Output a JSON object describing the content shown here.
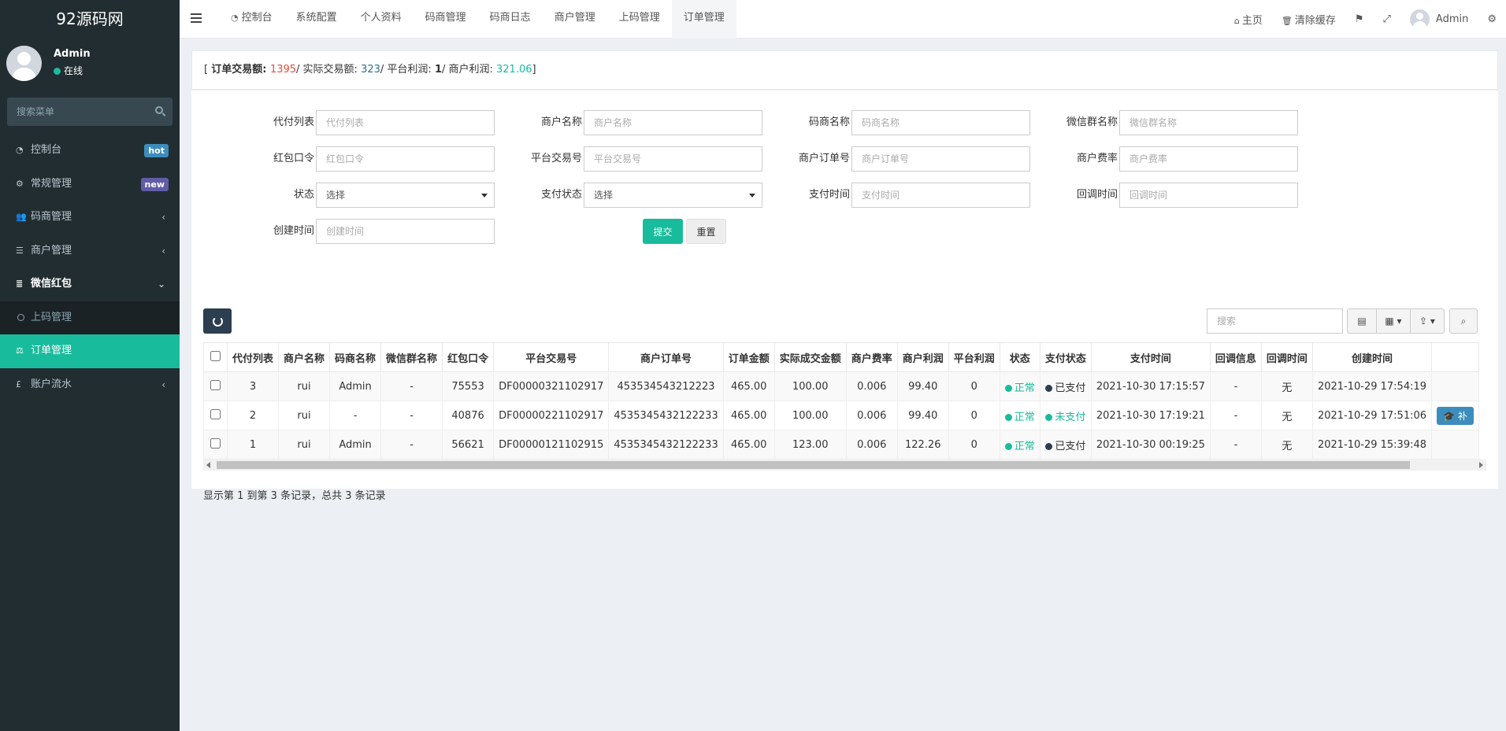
{
  "sidebar": {
    "logo": "92源码网",
    "user_name": "Admin",
    "user_status": "在线",
    "search_placeholder": "搜索菜单",
    "items": [
      {
        "label": "控制台",
        "badge": "hot"
      },
      {
        "label": "常规管理",
        "badge": "new"
      },
      {
        "label": "码商管理"
      },
      {
        "label": "商户管理"
      },
      {
        "label": "微信红包"
      },
      {
        "label": "上码管理"
      },
      {
        "label": "订单管理"
      },
      {
        "label": "账户流水"
      }
    ]
  },
  "topnav": {
    "tabs": [
      "控制台",
      "系统配置",
      "个人资料",
      "码商管理",
      "码商日志",
      "商户管理",
      "上码管理",
      "订单管理"
    ],
    "home": "主页",
    "clear_cache": "清除缓存",
    "user": "Admin"
  },
  "stats": {
    "label_order": "订单交易额: ",
    "order_amount": "1395",
    "label_actual": "/ 实际交易额: ",
    "actual_amount": "323",
    "label_platform": "/ 平台利润: ",
    "platform_profit": "1",
    "label_merchant": "/ 商户利润: ",
    "merchant_profit": "321.06"
  },
  "form": {
    "fields": [
      {
        "label": "代付列表",
        "placeholder": "代付列表"
      },
      {
        "label": "商户名称",
        "placeholder": "商户名称"
      },
      {
        "label": "码商名称",
        "placeholder": "码商名称"
      },
      {
        "label": "微信群名称",
        "placeholder": "微信群名称"
      },
      {
        "label": "红包口令",
        "placeholder": "红包口令"
      },
      {
        "label": "平台交易号",
        "placeholder": "平台交易号"
      },
      {
        "label": "商户订单号",
        "placeholder": "商户订单号"
      },
      {
        "label": "商户费率",
        "placeholder": "商户费率"
      },
      {
        "label": "状态",
        "value": "选择"
      },
      {
        "label": "支付状态",
        "value": "选择"
      },
      {
        "label": "支付时间",
        "placeholder": "支付时间"
      },
      {
        "label": "回调时间",
        "placeholder": "回调时间"
      },
      {
        "label": "创建时间",
        "placeholder": "创建时间"
      }
    ],
    "submit": "提交",
    "reset": "重置"
  },
  "table": {
    "search_placeholder": "搜索",
    "headers": [
      "代付列表",
      "商户名称",
      "码商名称",
      "微信群名称",
      "红包口令",
      "平台交易号",
      "商户订单号",
      "订单金额",
      "实际成交金额",
      "商户费率",
      "商户利润",
      "平台利润",
      "状态",
      "支付状态",
      "支付时间",
      "回调信息",
      "回调时间",
      "创建时间"
    ],
    "rows": [
      [
        "3",
        "rui",
        "Admin",
        "-",
        "75553",
        "DF00000321102917",
        "453534543212223",
        "465.00",
        "100.00",
        "0.006",
        "99.40",
        "0",
        "正常",
        "已支付",
        "2021-10-30 17:15:57",
        "-",
        "无",
        "2021-10-29 17:54:19"
      ],
      [
        "2",
        "rui",
        "-",
        "-",
        "40876",
        "DF00000221102917",
        "4535345432122233",
        "465.00",
        "100.00",
        "0.006",
        "99.40",
        "0",
        "正常",
        "未支付",
        "2021-10-30 17:19:21",
        "-",
        "无",
        "2021-10-29 17:51:06"
      ],
      [
        "1",
        "rui",
        "Admin",
        "-",
        "56621",
        "DF00000121102915",
        "4535345432122233",
        "465.00",
        "123.00",
        "0.006",
        "122.26",
        "0",
        "正常",
        "已支付",
        "2021-10-30 00:19:25",
        "-",
        "无",
        "2021-10-29 15:39:48"
      ]
    ],
    "op_label": "补",
    "page_info": "显示第 1 到第 3 条记录，总共 3 条记录"
  },
  "colors": {
    "accent": "#18bc9c",
    "sidebar": "#222d32",
    "red": "#e74c3c"
  }
}
